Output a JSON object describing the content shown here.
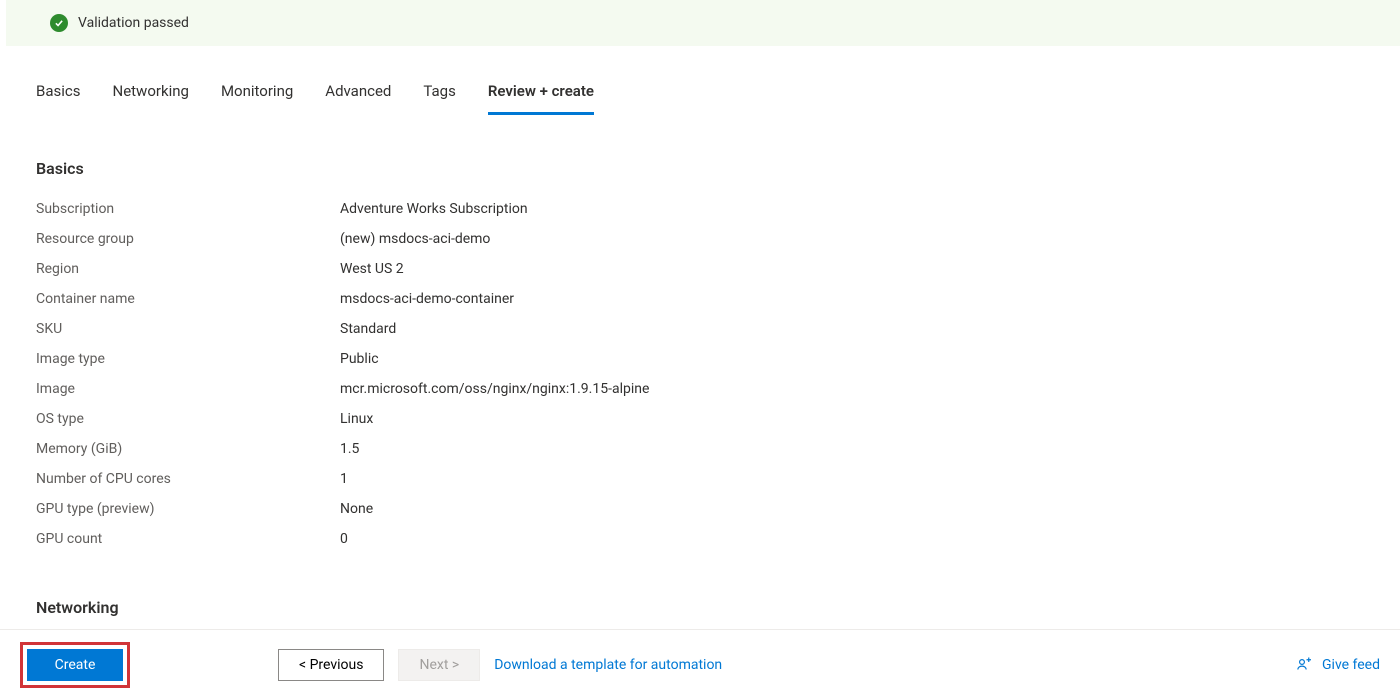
{
  "validation": {
    "message": "Validation passed"
  },
  "tabs": {
    "basics": "Basics",
    "networking": "Networking",
    "monitoring": "Monitoring",
    "advanced": "Advanced",
    "tags": "Tags",
    "review": "Review + create"
  },
  "sections": {
    "basics_title": "Basics",
    "networking_title": "Networking"
  },
  "basics": {
    "subscription_label": "Subscription",
    "subscription_value": "Adventure Works Subscription",
    "rg_label": "Resource group",
    "rg_value": "(new) msdocs-aci-demo",
    "region_label": "Region",
    "region_value": "West US 2",
    "cname_label": "Container name",
    "cname_value": "msdocs-aci-demo-container",
    "sku_label": "SKU",
    "sku_value": "Standard",
    "imgtype_label": "Image type",
    "imgtype_value": "Public",
    "image_label": "Image",
    "image_value": "mcr.microsoft.com/oss/nginx/nginx:1.9.15-alpine",
    "os_label": "OS type",
    "os_value": "Linux",
    "mem_label": "Memory (GiB)",
    "mem_value": "1.5",
    "cpu_label": "Number of CPU cores",
    "cpu_value": "1",
    "gpu_type_label": "GPU type (preview)",
    "gpu_type_value": "None",
    "gpu_count_label": "GPU count",
    "gpu_count_value": "0"
  },
  "footer": {
    "create": "Create",
    "previous": "<  Previous",
    "next": "Next  >",
    "download_template": "Download a template for automation",
    "feedback": "Give feed"
  }
}
